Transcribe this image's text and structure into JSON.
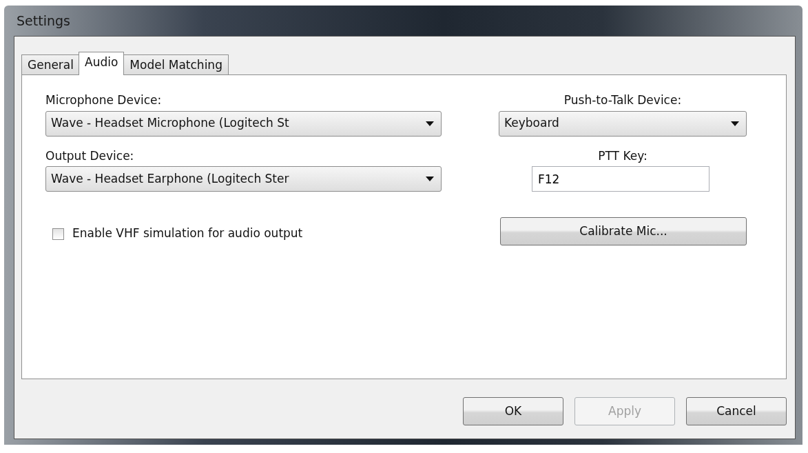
{
  "window": {
    "title": "Settings"
  },
  "tabs": [
    {
      "label": "General",
      "selected": false
    },
    {
      "label": "Audio",
      "selected": true
    },
    {
      "label": "Model Matching",
      "selected": false
    }
  ],
  "microphone": {
    "label": "Microphone Device:",
    "value": "Wave - Headset Microphone (Logitech St"
  },
  "output": {
    "label": "Output Device:",
    "value": "Wave - Headset Earphone (Logitech Ster"
  },
  "ptt_device": {
    "label": "Push-to-Talk Device:",
    "value": "Keyboard"
  },
  "ptt_key": {
    "label": "PTT Key:",
    "value": "F12"
  },
  "vhf": {
    "label": "Enable VHF simulation for audio output",
    "checked": false
  },
  "calibrate": {
    "label": "Calibrate Mic..."
  },
  "buttons": [
    {
      "label": "OK",
      "disabled": false
    },
    {
      "label": "Apply",
      "disabled": true
    },
    {
      "label": "Cancel",
      "disabled": false
    }
  ]
}
